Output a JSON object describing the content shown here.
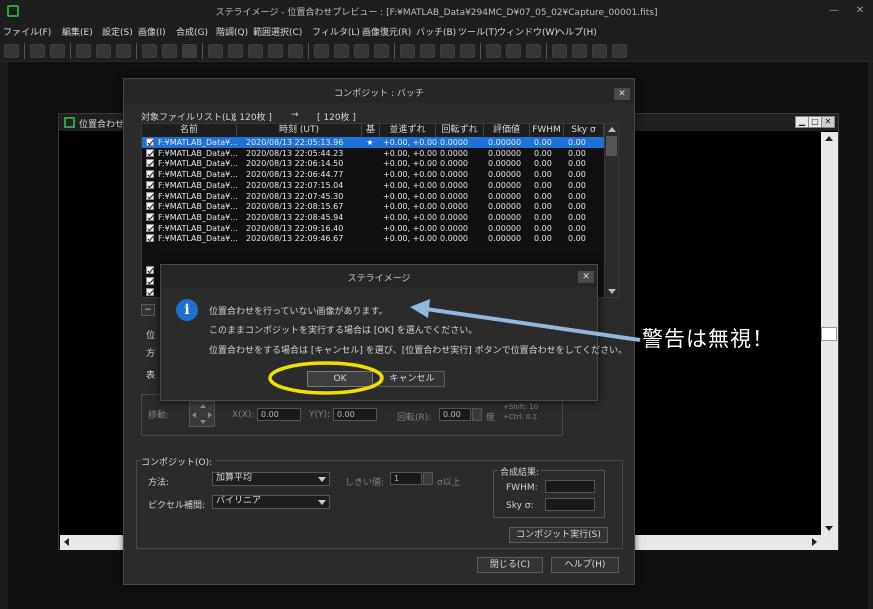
{
  "window": {
    "title": "ステライメージ - 位置合わせプレビュー : [F:¥MATLAB_Data¥294MC_D¥07_05_02¥Capture_00001.fits]"
  },
  "menu": [
    "ファイル(F)",
    "編集(E)",
    "設定(S)",
    "画像(I)",
    "合成(G)",
    "階調(Q)",
    "範囲選択(C)",
    "フィルタ(L)",
    "画像復元(R)",
    "バッチ(B)",
    "ツール(T)",
    "ウィンドウ(W)",
    "ヘルプ(H)"
  ],
  "preview": {
    "title": "位置合わせ"
  },
  "composite": {
    "title": "コンポジット : バッチ",
    "filelist_label": "対象ファイルリスト(L):",
    "count_from": "[ 120枚 ]",
    "arrow": "→",
    "count_to": "[ 120枚 ]",
    "columns": [
      "名前",
      "時刻 (UT)",
      "基準",
      "並進ずれ",
      "回転ずれ",
      "評価値",
      "FWHM",
      "Sky σ"
    ],
    "rows": [
      {
        "name": "F:¥MATLAB_Data¥...",
        "time": "2020/08/13 22:05:13.96",
        "ref": "★",
        "shift": "+0.00, +0.00",
        "rot": "0.0000",
        "score": "0.00000",
        "fwhm": "0.00",
        "sky": "0.00",
        "selected": true
      },
      {
        "name": "F:¥MATLAB_Data¥...",
        "time": "2020/08/13 22:05:44.23",
        "ref": "",
        "shift": "+0.00, +0.00",
        "rot": "0.0000",
        "score": "0.00000",
        "fwhm": "0.00",
        "sky": "0.00"
      },
      {
        "name": "F:¥MATLAB_Data¥...",
        "time": "2020/08/13 22:06:14.50",
        "ref": "",
        "shift": "+0.00, +0.00",
        "rot": "0.0000",
        "score": "0.00000",
        "fwhm": "0.00",
        "sky": "0.00"
      },
      {
        "name": "F:¥MATLAB_Data¥...",
        "time": "2020/08/13 22:06:44.77",
        "ref": "",
        "shift": "+0.00, +0.00",
        "rot": "0.0000",
        "score": "0.00000",
        "fwhm": "0.00",
        "sky": "0.00"
      },
      {
        "name": "F:¥MATLAB_Data¥...",
        "time": "2020/08/13 22:07:15.04",
        "ref": "",
        "shift": "+0.00, +0.00",
        "rot": "0.0000",
        "score": "0.00000",
        "fwhm": "0.00",
        "sky": "0.00"
      },
      {
        "name": "F:¥MATLAB_Data¥...",
        "time": "2020/08/13 22:07:45.30",
        "ref": "",
        "shift": "+0.00, +0.00",
        "rot": "0.0000",
        "score": "0.00000",
        "fwhm": "0.00",
        "sky": "0.00"
      },
      {
        "name": "F:¥MATLAB_Data¥...",
        "time": "2020/08/13 22:08:15.67",
        "ref": "",
        "shift": "+0.00, +0.00",
        "rot": "0.0000",
        "score": "0.00000",
        "fwhm": "0.00",
        "sky": "0.00"
      },
      {
        "name": "F:¥MATLAB_Data¥...",
        "time": "2020/08/13 22:08:45.94",
        "ref": "",
        "shift": "+0.00, +0.00",
        "rot": "0.0000",
        "score": "0.00000",
        "fwhm": "0.00",
        "sky": "0.00"
      },
      {
        "name": "F:¥MATLAB_Data¥...",
        "time": "2020/08/13 22:09:16.40",
        "ref": "",
        "shift": "+0.00, +0.00",
        "rot": "0.0000",
        "score": "0.00000",
        "fwhm": "0.00",
        "sky": "0.00"
      },
      {
        "name": "F:¥MATLAB_Data¥...",
        "time": "2020/08/13 22:09:46.67",
        "ref": "",
        "shift": "+0.00, +0.00",
        "rot": "0.0000",
        "score": "0.00000",
        "fwhm": "0.00",
        "sky": "0.00"
      }
    ],
    "move_label": "移動:",
    "x_label": "X(X):",
    "x_value": "0.00",
    "y_label": "Y(Y):",
    "y_value": "0.00",
    "rot_label": "回転(R):",
    "rot_value": "0.00",
    "deg": "度",
    "shift_hint": "+Shift: 10",
    "ctrl_hint": "+Ctrl: 0.1",
    "composite_group": "コンポジット(O):",
    "method_label": "方法:",
    "method_value": "加算平均",
    "threshold_label": "しきい値:",
    "threshold_value": "1",
    "sigma_label": "σ以上",
    "interp_label": "ピクセル補間:",
    "interp_value": "バイリニア",
    "result_label": "合成結果:",
    "fwhm_label": "FWHM:",
    "sky_label": "Sky σ:",
    "run_button": "コンポジット実行(S)",
    "close_button": "閉じる(C)",
    "help_button": "ヘルプ(H)",
    "partial_label_1": "位",
    "partial_label_2": "方",
    "partial_label_3": "表"
  },
  "message": {
    "title": "ステライメージ",
    "line1": "位置合わせを行っていない画像があります。",
    "line2": "このままコンポジットを実行する場合は [OK] を選んでください。",
    "line3": "位置合わせをする場合は [キャンセル] を選び、[位置合わせ実行] ボタンで位置合わせをしてください。",
    "ok": "OK",
    "cancel": "キャンセル"
  },
  "annotation": {
    "text": "警告は無視！",
    "highlight_color": "#f0e000",
    "arrow_color": "#8fb8e0"
  }
}
